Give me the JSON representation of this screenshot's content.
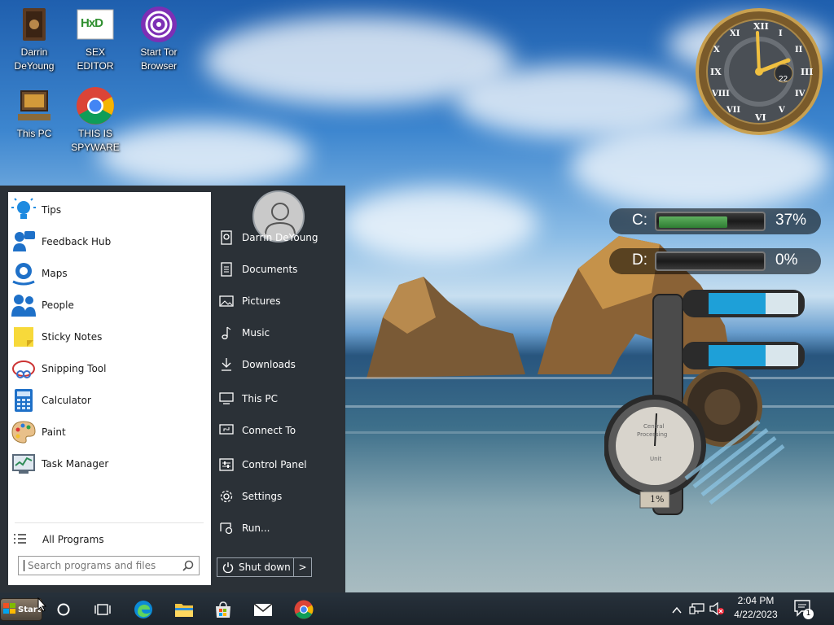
{
  "desktop": {
    "icons": [
      {
        "label_1": "Darrin",
        "label_2": "DeYoung",
        "icon": "user-folder-icon"
      },
      {
        "label_1": "SEX",
        "label_2": "EDITOR",
        "icon": "hex-editor-icon"
      },
      {
        "label_1": "Start Tor",
        "label_2": "Browser",
        "icon": "tor-browser-icon"
      },
      {
        "label_1": "This PC",
        "label_2": "",
        "icon": "this-pc-icon"
      },
      {
        "label_1": "THIS IS",
        "label_2": "SPYWARE",
        "icon": "chrome-icon"
      }
    ],
    "hex_editor_glyph": "HxD"
  },
  "start_menu": {
    "programs": [
      {
        "label": "Tips",
        "icon": "lightbulb-icon"
      },
      {
        "label": "Feedback Hub",
        "icon": "feedback-icon"
      },
      {
        "label": "Maps",
        "icon": "map-icon"
      },
      {
        "label": "People",
        "icon": "people-icon"
      },
      {
        "label": "Sticky Notes",
        "icon": "sticky-note-icon"
      },
      {
        "label": "Snipping Tool",
        "icon": "scissors-icon"
      },
      {
        "label": "Calculator",
        "icon": "calculator-icon"
      },
      {
        "label": "Paint",
        "icon": "palette-icon"
      },
      {
        "label": "Task Manager",
        "icon": "task-manager-icon"
      }
    ],
    "all_programs": "All Programs",
    "search_placeholder": "Search programs and files",
    "places": [
      {
        "label": "Darrin DeYoung",
        "icon": "user-icon"
      },
      {
        "label": "Documents",
        "icon": "document-icon"
      },
      {
        "label": "Pictures",
        "icon": "picture-icon"
      },
      {
        "label": "Music",
        "icon": "music-note-icon"
      },
      {
        "label": "Downloads",
        "icon": "download-icon"
      },
      {
        "label": "This PC",
        "icon": "monitor-icon"
      },
      {
        "label": "Connect To",
        "icon": "connect-icon"
      },
      {
        "label": "Control Panel",
        "icon": "control-panel-icon"
      },
      {
        "label": "Settings",
        "icon": "gear-icon"
      },
      {
        "label": "Run...",
        "icon": "run-icon"
      }
    ],
    "shutdown_label": "Shut down",
    "shutdown_arrow": ">"
  },
  "gadgets": {
    "clock": {
      "numerals": [
        "XII",
        "I",
        "II",
        "III",
        "IV",
        "V",
        "VI",
        "VII",
        "VIII",
        "IX",
        "X",
        "XI"
      ],
      "date": "22"
    },
    "drives": [
      {
        "label": "C:",
        "percent_text": "37%",
        "fill": 0.37
      },
      {
        "label": "D:",
        "percent_text": "0%",
        "fill": 0.0
      }
    ],
    "gauge": {
      "title_1": "Central",
      "title_2": "Processing",
      "title_3": "Unit",
      "percent_text": "1%"
    }
  },
  "taskbar": {
    "start_label": "Start",
    "pinned": [
      {
        "icon": "cortana-circle-icon"
      },
      {
        "icon": "task-view-icon"
      },
      {
        "icon": "edge-icon"
      },
      {
        "icon": "file-explorer-icon"
      },
      {
        "icon": "store-icon"
      },
      {
        "icon": "mail-icon"
      },
      {
        "icon": "chrome-icon"
      }
    ],
    "tray": {
      "time": "2:04 PM",
      "date": "4/22/2023",
      "notification_count": "1"
    }
  },
  "colors": {
    "taskbar": "#1f2830",
    "start_menu_right": "#2b3137",
    "accent_blue": "#0078d7",
    "drive_fill": "#2e7d32"
  }
}
